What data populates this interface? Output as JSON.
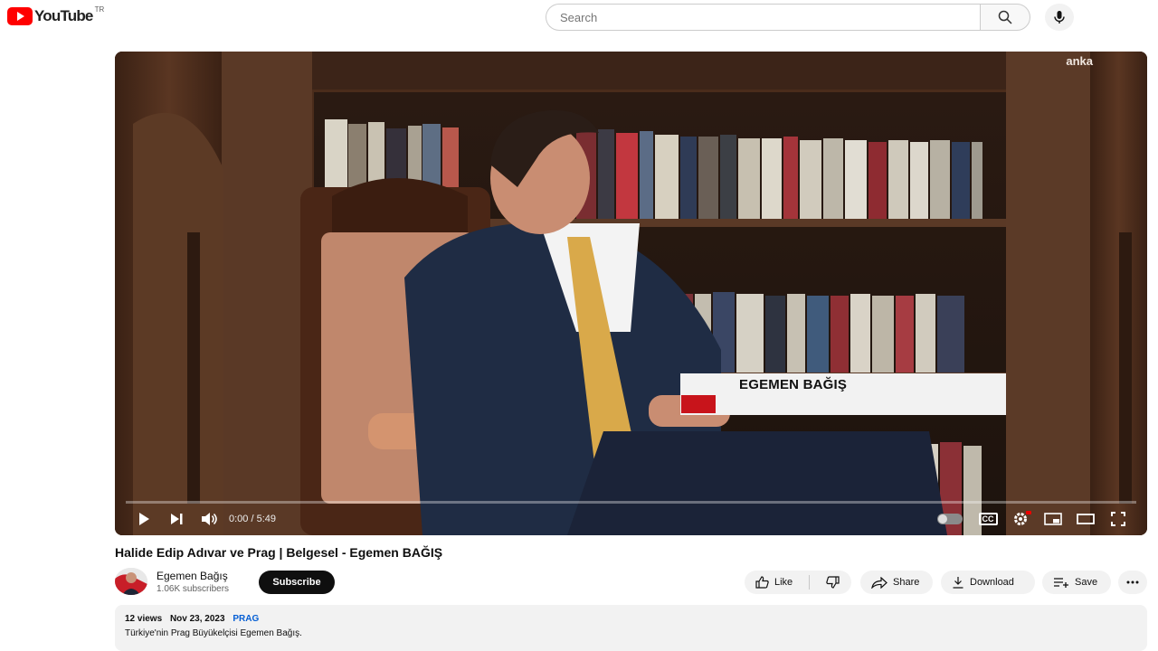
{
  "header": {
    "logo_text": "YouTube",
    "logo_superscript": "TR",
    "search_placeholder": "Search"
  },
  "player": {
    "watermark": "anka",
    "lower_third_name": "EGEMEN BAĞIŞ",
    "time_display": "0:00 / 5:49",
    "progress_fraction": 0,
    "cc_label": "CC"
  },
  "video": {
    "title": "Halide Edip Adıvar ve Prag | Belgesel - Egemen BAĞIŞ"
  },
  "channel": {
    "name": "Egemen Bağış",
    "subscribers": "1.06K subscribers",
    "subscribe_label": "Subscribe"
  },
  "actions": {
    "like_label": "Like",
    "share_label": "Share",
    "download_label": "Download",
    "save_label": "Save"
  },
  "description": {
    "views": "12 views",
    "date": "Nov 23, 2023",
    "tag": "PRAG",
    "text": "Türkiye'nin Prag Büyükelçisi Egemen Bağış."
  },
  "colors": {
    "brand_red": "#ff0000",
    "lower_third_red": "#c8141b",
    "link_blue": "#065fd4"
  }
}
